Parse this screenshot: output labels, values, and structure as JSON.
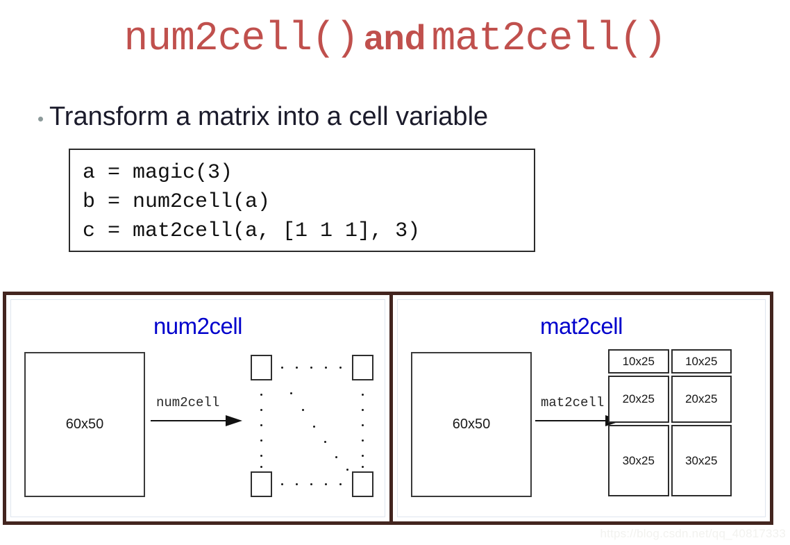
{
  "slide": {
    "title": {
      "part1": "num2cell()",
      "conjunction": "and",
      "part2": "mat2cell()",
      "color": "#c0504d"
    },
    "bullet": {
      "text": "Transform a matrix into a cell variable",
      "marker": "bullet-dot"
    },
    "code_block": {
      "lines": [
        "a = magic(3)",
        "b = num2cell(a)",
        "c = mat2cell(a, [1 1 1], 3)"
      ]
    },
    "watermark": "https://blog.csdn.net/qq_40817333"
  },
  "diagram": {
    "accent_border_color": "#43251f",
    "panel_title_color": "#0000cc",
    "panels": [
      {
        "id": "num2cell",
        "title": "num2cell",
        "source_label": "60x50",
        "arrow_label": "num2cell",
        "result_type": "scattered-cells",
        "result_note": "grid of 1x1 cells shown as four corner squares with ellipsis dots"
      },
      {
        "id": "mat2cell",
        "title": "mat2cell",
        "source_label": "60x50",
        "arrow_label": "mat2cell",
        "result_type": "block-grid",
        "grid": {
          "columns": 2,
          "rows": 3,
          "cells": [
            [
              "10x25",
              "10x25"
            ],
            [
              "20x25",
              "20x25"
            ],
            [
              "30x25",
              "30x25"
            ]
          ]
        }
      }
    ]
  }
}
